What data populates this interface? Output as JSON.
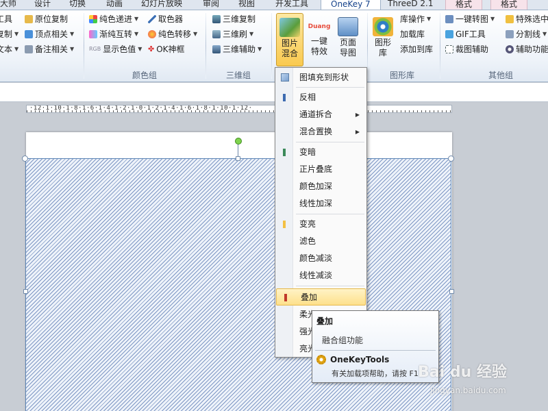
{
  "tabs": [
    {
      "label": "大师"
    },
    {
      "label": "设计"
    },
    {
      "label": "切换"
    },
    {
      "label": "动画"
    },
    {
      "label": "幻灯片放映"
    },
    {
      "label": "审阅"
    },
    {
      "label": "视图"
    },
    {
      "label": "开发工具"
    },
    {
      "label": "OneKey 7"
    },
    {
      "label": "ThreeD 2.1"
    },
    {
      "label": "格式"
    },
    {
      "label": "格式"
    }
  ],
  "ribbon": {
    "group1": {
      "items": [
        "工具",
        "复制",
        "文本"
      ],
      "items2": [
        "原位复制",
        "顶点相关",
        "备注相关"
      ]
    },
    "color_group": {
      "label": "颜色组",
      "items": [
        "纯色递进",
        "渐纯互转",
        "显示色值",
        "取色器",
        "纯色转移",
        "OK神框"
      ]
    },
    "three_d_group": {
      "label": "三维组",
      "items": [
        "三维复制",
        "三维刷",
        "三维辅助"
      ]
    },
    "big_buttons": {
      "image_blend": "图片\n混合",
      "one_click": "一键\n特效",
      "page_image": "页面\n导图",
      "duang": "Duang",
      "shape_lib": "图形\n库"
    },
    "shape_lib_group": {
      "label": "图形库",
      "items": [
        "库操作",
        "加载库",
        "添加到库"
      ]
    },
    "other_group": {
      "label": "其他组",
      "items": [
        "一键转图",
        "GIF工具",
        "裁图辅助",
        "特殊选中",
        "分割线",
        "辅助功能"
      ]
    }
  },
  "ruler": {
    "text": "·12·1·10·1·8·1·6·1·4·1·2·1·0·1·2·1·4·1·6·1·8·1·10·1·12·"
  },
  "menu": {
    "items": [
      {
        "label": "图填充到形状"
      },
      {
        "label": "反相"
      },
      {
        "label": "通道拆合"
      },
      {
        "label": "混合置换"
      },
      {
        "label": "变暗"
      },
      {
        "label": "正片叠底"
      },
      {
        "label": "颜色加深"
      },
      {
        "label": "线性加深"
      },
      {
        "label": "变亮"
      },
      {
        "label": "滤色"
      },
      {
        "label": "颜色减淡"
      },
      {
        "label": "线性减淡"
      },
      {
        "label": "叠加"
      },
      {
        "label": "柔光"
      },
      {
        "label": "强光"
      },
      {
        "label": "亮光"
      }
    ],
    "colors": {
      "invert": "#3d6bb0",
      "darken": "#3c8a5a",
      "lighten": "#f3c044",
      "overlay": "#c0392b"
    }
  },
  "tooltip": {
    "title": "叠加",
    "desc": "融合组功能",
    "addin": "OneKeyTools",
    "help": "有关加载项帮助，请按 F1"
  },
  "watermark": {
    "brand": "Bai du 经验",
    "url": "jingyan.baidu.com"
  }
}
